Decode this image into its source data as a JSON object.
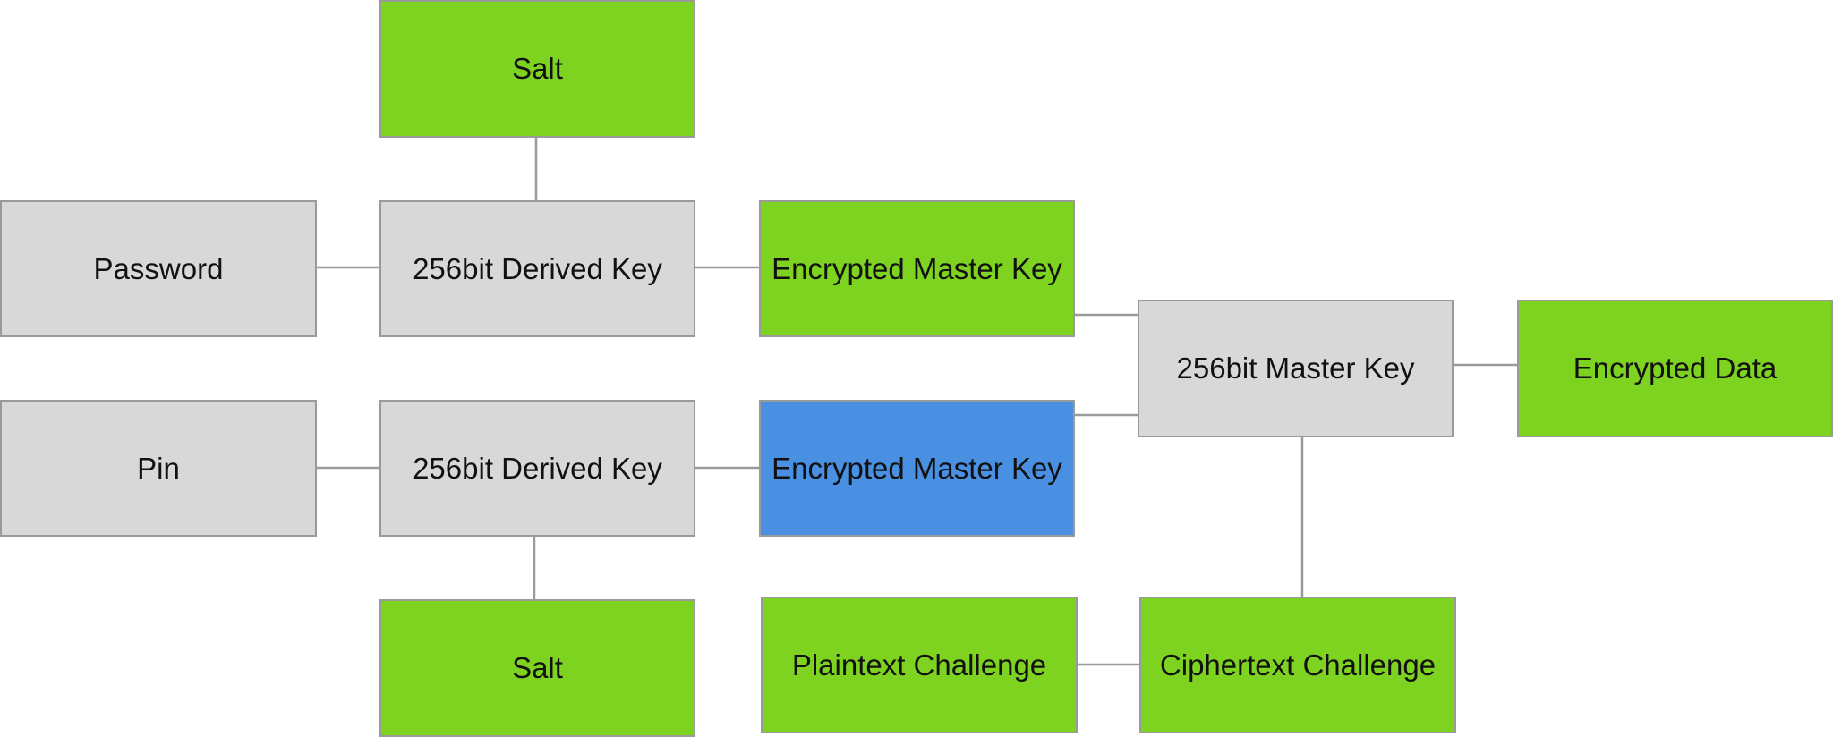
{
  "nodes": {
    "salt_top": {
      "label": "Salt",
      "color": "#7ed321"
    },
    "password": {
      "label": "Password",
      "color": "#d8d8d8"
    },
    "derived_key_password": {
      "label": "256bit Derived Key",
      "color": "#d8d8d8"
    },
    "encrypted_master_key_password": {
      "label": "Encrypted Master Key",
      "color": "#7ed321"
    },
    "pin": {
      "label": "Pin",
      "color": "#d8d8d8"
    },
    "derived_key_pin": {
      "label": "256bit Derived Key",
      "color": "#d8d8d8"
    },
    "encrypted_master_key_pin": {
      "label": "Encrypted Master Key",
      "color": "#4a90e2"
    },
    "salt_bottom": {
      "label": "Salt",
      "color": "#7ed321"
    },
    "master_key": {
      "label": "256bit Master Key",
      "color": "#d8d8d8"
    },
    "encrypted_data": {
      "label": "Encrypted Data",
      "color": "#7ed321"
    },
    "plaintext_challenge": {
      "label": "Plaintext Challenge",
      "color": "#7ed321"
    },
    "ciphertext_challenge": {
      "label": "Ciphertext Challenge",
      "color": "#7ed321"
    }
  }
}
